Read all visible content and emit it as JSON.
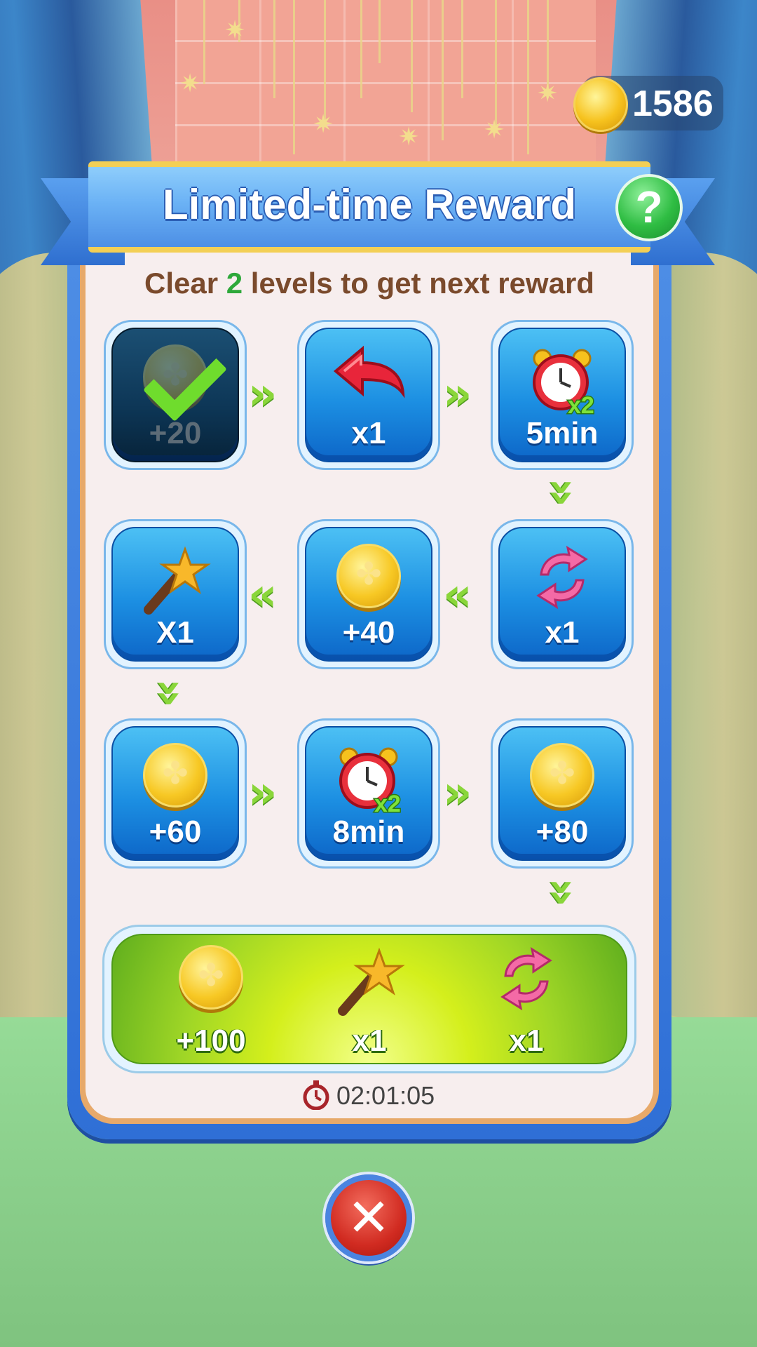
{
  "header": {
    "coin_balance": "1586",
    "title": "Limited-time Reward",
    "help_symbol": "?"
  },
  "subtitle": {
    "prefix": "Clear",
    "count": "2",
    "suffix": "levels to get next reward"
  },
  "rewards": [
    {
      "icon": "coin-icon",
      "label": "+20",
      "status": "claimed"
    },
    {
      "icon": "undo-icon",
      "label": "x1",
      "status": "locked"
    },
    {
      "icon": "double-time-clock-icon",
      "label": "5min",
      "status": "locked"
    },
    {
      "icon": "refresh-icon",
      "label": "x1",
      "status": "locked"
    },
    {
      "icon": "coin-icon",
      "label": "+40",
      "status": "locked"
    },
    {
      "icon": "magic-wand-icon",
      "label": "X1",
      "status": "locked"
    },
    {
      "icon": "coin-icon",
      "label": "+60",
      "status": "locked"
    },
    {
      "icon": "double-time-clock-icon",
      "label": "8min",
      "status": "locked"
    },
    {
      "icon": "coin-icon",
      "label": "+80",
      "status": "locked"
    }
  ],
  "grand_prize": [
    {
      "icon": "coin-icon",
      "label": "+100"
    },
    {
      "icon": "magic-wand-icon",
      "label": "x1"
    },
    {
      "icon": "refresh-icon",
      "label": "x1"
    }
  ],
  "timer": "02:01:05",
  "colors": {
    "title_blue": "#6bb2f5",
    "tile_blue": "#1c8fe2",
    "arrow_green": "#8ad63a",
    "grand_green": "#d4ef1c",
    "close_red": "#d12b21"
  }
}
